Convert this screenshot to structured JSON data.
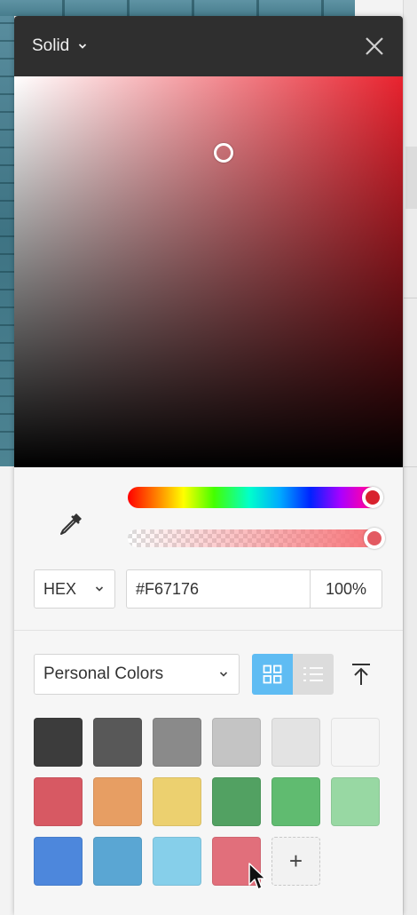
{
  "header": {
    "mode_label": "Solid",
    "mode_chevron_icon": "chevron-down-icon",
    "close_icon": "close-icon"
  },
  "picker": {
    "base_hue_color": "#e8222e",
    "hue_color": "#d8222e",
    "selected_color": "#F67176",
    "alpha_percent": 100
  },
  "tools": {
    "eyedropper_icon": "eyedropper-icon"
  },
  "format": {
    "selected": "HEX",
    "hex_value": "#F67176",
    "opacity_value": "100%"
  },
  "palette": {
    "selected": "Personal Colors",
    "view_grid_icon": "grid-view-icon",
    "view_list_icon": "list-view-icon",
    "upload_icon": "upload-icon",
    "add_label": "+",
    "swatches": [
      "#3c3c3c",
      "#585858",
      "#8a8a8a",
      "#c4c4c4",
      "#e3e3e3",
      "#f5f5f5",
      "#d75963",
      "#e79e63",
      "#ecd06f",
      "#52a162",
      "#60bb70",
      "#98d8a3",
      "#4d87dc",
      "#5aa6d3",
      "#86cfea",
      "#e16f7b"
    ]
  },
  "theme": {
    "header_bg": "#2f2f2f",
    "accent": "#5fbcf3"
  }
}
